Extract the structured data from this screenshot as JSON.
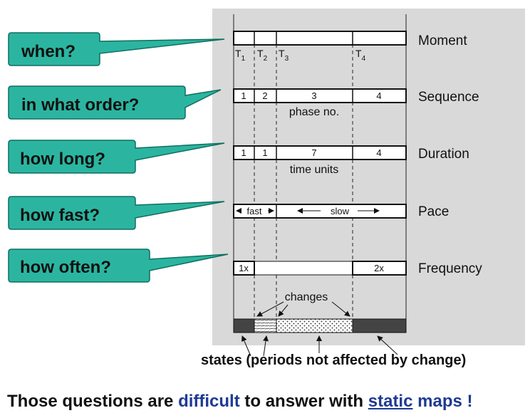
{
  "questions": [
    "when?",
    "in what order?",
    "how long?",
    "how fast?",
    "how often?"
  ],
  "rows": {
    "moment": {
      "label": "Moment",
      "t_labels": [
        "T",
        "T",
        "T",
        "T"
      ],
      "t_subs": [
        "1",
        "2",
        "3",
        "4"
      ]
    },
    "sequence": {
      "label": "Sequence",
      "cells": [
        "1",
        "2",
        "3",
        "4"
      ],
      "sub": "phase no."
    },
    "duration": {
      "label": "Duration",
      "cells": [
        "1",
        "1",
        "7",
        "4"
      ],
      "sub": "time units"
    },
    "pace": {
      "label": "Pace",
      "fast": "fast",
      "slow": "slow"
    },
    "frequency": {
      "label": "Frequency",
      "cells": [
        "1x",
        "2x"
      ]
    }
  },
  "changes_label": "changes",
  "caption": "states (periods not affected by change)",
  "footer": {
    "part1": "Those questions are ",
    "difficult": "difficult",
    "part2": " to answer with ",
    "static": "static",
    "maps": "maps",
    "end": " !"
  },
  "colors": {
    "bubble": "#2bb5a0",
    "panel": "#d9d9d9",
    "highlight": "#1f3a93",
    "state_fill": "#444444"
  }
}
